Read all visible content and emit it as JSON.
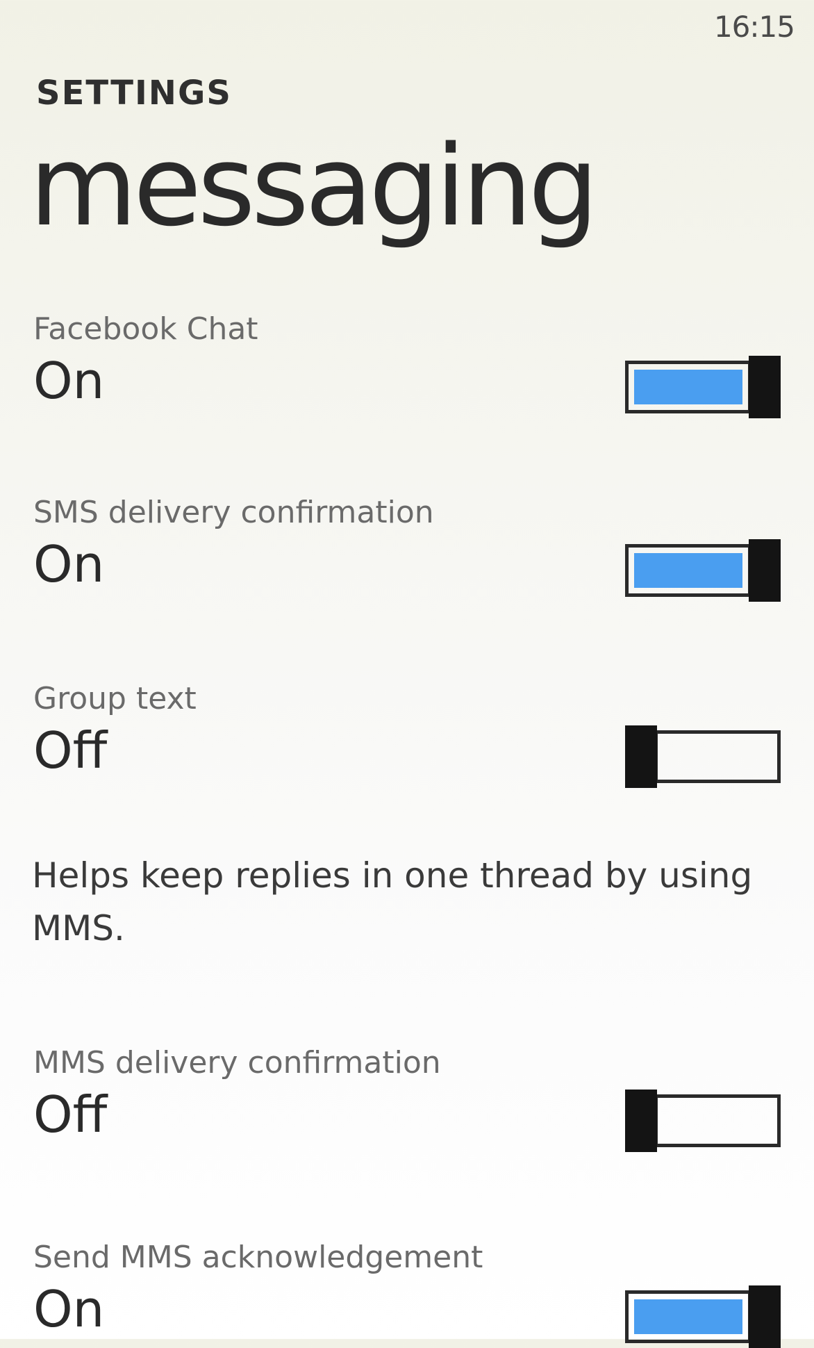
{
  "status": {
    "time": "16:15"
  },
  "header": {
    "app_title": "SETTINGS",
    "page_title": "messaging"
  },
  "settings": [
    {
      "label": "Facebook Chat",
      "value": "On",
      "state": "on"
    },
    {
      "label": "SMS delivery confirmation",
      "value": "On",
      "state": "on"
    },
    {
      "label": "Group text",
      "value": "Off",
      "state": "off",
      "description": "Helps keep replies in one thread by using MMS."
    },
    {
      "label": "MMS delivery confirmation",
      "value": "Off",
      "state": "off"
    },
    {
      "label": "Send MMS acknowledgement",
      "value": "On",
      "state": "on"
    }
  ],
  "colors": {
    "accent": "#4a9ef0",
    "thumb": "#141414",
    "background": "#f4f4ec"
  }
}
